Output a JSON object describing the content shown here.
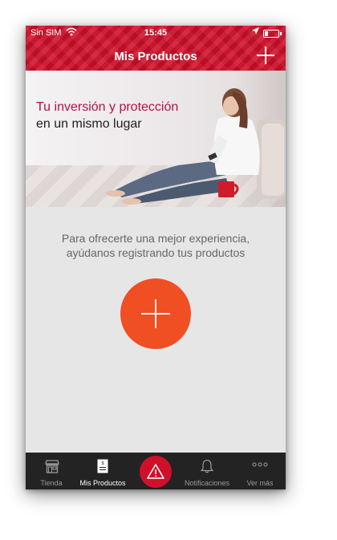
{
  "status": {
    "carrier": "Sin SIM",
    "time": "15:45"
  },
  "nav": {
    "title": "Mis Productos"
  },
  "banner": {
    "headline_line1": "Tu inversión y protección",
    "headline_line2": "en un mismo lugar"
  },
  "main": {
    "message_line1": "Para ofrecerte una mejor experiencia,",
    "message_line2": "ayúdanos registrando tus productos"
  },
  "tabs": [
    {
      "label": "Tienda",
      "icon": "store-icon"
    },
    {
      "label": "Mis Productos",
      "icon": "document-icon"
    },
    {
      "label": "",
      "icon": "alert-icon"
    },
    {
      "label": "Notificaciones",
      "icon": "bell-icon"
    },
    {
      "label": "Ver más",
      "icon": "more-icon"
    }
  ],
  "colors": {
    "brand_red": "#d0102a",
    "fab_orange": "#f04e23",
    "headline_accent": "#b0124a",
    "tabbar": "#232323"
  }
}
